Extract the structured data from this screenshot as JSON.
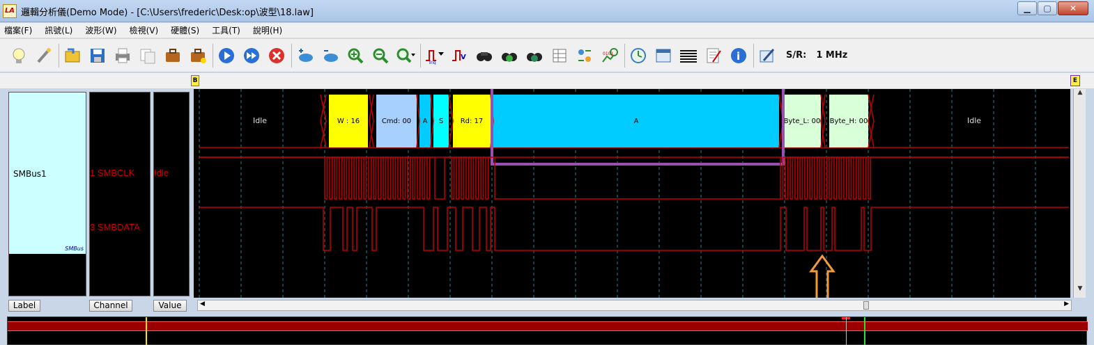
{
  "window": {
    "title": "邏輯分析儀(Demo Mode) - [C:\\Users\\frederic\\Desk:op\\波型\\18.law]",
    "icon_text": "LA"
  },
  "menu": [
    "檔案(F)",
    "訊號(L)",
    "波形(W)",
    "檢視(V)",
    "硬體(S)",
    "工具(T)",
    "說明(H)"
  ],
  "toolbar": {
    "icons": [
      "bulb-icon",
      "wand-icon",
      "open-icon",
      "save-icon",
      "print-icon",
      "copy-icon",
      "case-icon",
      "case-star-icon",
      "run-icon",
      "run-repeat-icon",
      "stop-icon",
      "add-channel-icon",
      "remove-channel-icon",
      "zoom-in-icon",
      "zoom-out-icon",
      "zoom-menu-icon",
      "trigger-icon",
      "trigger-value-icon",
      "find-icon",
      "find-next-icon",
      "find-prev-icon",
      "table-icon",
      "bus-icon",
      "stats-icon",
      "timer-icon",
      "window-icon",
      "lines-icon",
      "notes-icon",
      "info-icon",
      "edit-icon"
    ],
    "sr_label": "S/R:",
    "sr_value": "1 MHz"
  },
  "ruler": {
    "marker_b": "B",
    "marker_e": "E"
  },
  "panels": {
    "bus_name": "SMBus1",
    "bus_tag": "SMBus",
    "channel_1": "1 SMBCLK",
    "channel_3": "3 SMBDATA",
    "value": "Idle"
  },
  "decode_labels": {
    "idle_left": "Idle",
    "w": "W : 16",
    "cmd": "Cmd: 00",
    "a1": "A",
    "s": "S",
    "rd": "Rd: 17",
    "a2": "A",
    "byte_l": "Byte_L: 00",
    "byte_h": "Byte_H: 00",
    "idle_right": "Idle"
  },
  "bottom_tabs": {
    "label": "Label",
    "channel": "Channel",
    "value": "Value"
  },
  "colors": {
    "wave": "#c00000",
    "packet_yellow": "#ffff00",
    "packet_lightblue": "#a8d0ff",
    "packet_cyan": "#00ccff",
    "packet_green": "#d8ffd8",
    "highlight": "#9b4fb0",
    "arrow": "#f59a3c"
  }
}
